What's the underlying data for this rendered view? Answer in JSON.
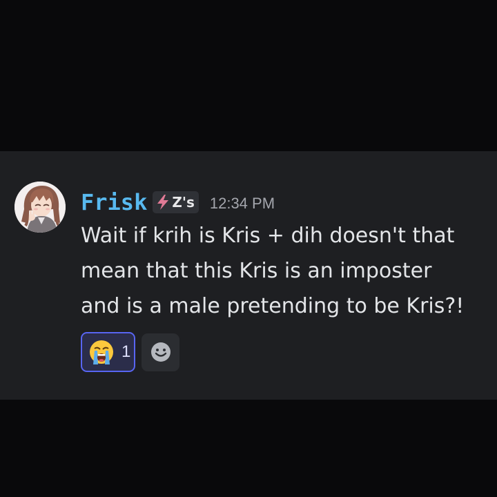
{
  "message": {
    "author": "Frisk",
    "tag": {
      "icon": "lightning-bolt-icon",
      "label": "Z's",
      "icon_color": "#e27a96"
    },
    "timestamp": "12:34 PM",
    "lines": [
      "Wait if krih is Kris + dih doesn't that",
      "mean that this Kris is an imposter",
      "and is a male pretending to be Kris?!"
    ],
    "avatar": "anime-girl-avatar",
    "reactions": [
      {
        "emoji": "loudly-crying-face-icon",
        "count": "1",
        "active": true
      }
    ],
    "add_reaction_icon": "smiley-add-reaction-icon"
  },
  "colors": {
    "background": "#09090b",
    "panel": "#1e1f22",
    "username": "#58b9ef",
    "text": "#e3e5e8",
    "timestamp": "#a4a6ad",
    "reaction_border": "#5865f2",
    "reaction_fill": "#2b2d4a"
  }
}
